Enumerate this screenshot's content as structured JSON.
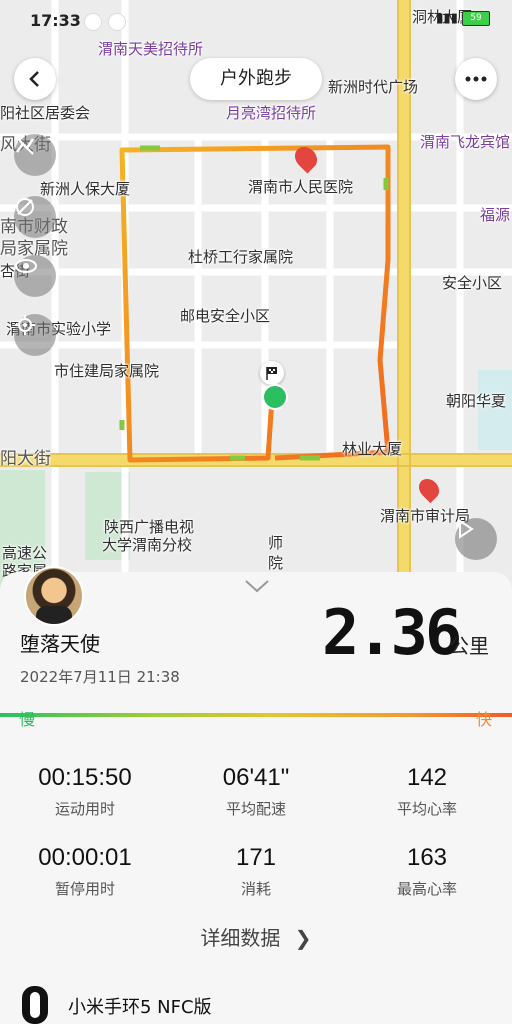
{
  "status_bar": {
    "time": "17:33",
    "battery": "59"
  },
  "header": {
    "back_icon": "back-arrow-icon",
    "title": "户外跑步",
    "more_icon": "more-dots-icon"
  },
  "map": {
    "labels": [
      {
        "text": "渭南天美招待所",
        "style": "purple"
      },
      {
        "text": "新洲时代广场",
        "style": "normal"
      },
      {
        "text": "月亮湾招待所",
        "style": "purple"
      },
      {
        "text": "阳社区居委会",
        "style": "normal"
      },
      {
        "text": "渭南飞龙宾馆",
        "style": "purple"
      },
      {
        "text": "风大街",
        "style": "big"
      },
      {
        "text": "渭南市人民医院",
        "style": "normal"
      },
      {
        "text": "新洲人保大厦",
        "style": "normal"
      },
      {
        "text": "福源",
        "style": "purple"
      },
      {
        "text": "南市财政",
        "style": "big"
      },
      {
        "text": "局家属院",
        "style": "big"
      },
      {
        "text": "杜桥工行家属院",
        "style": "normal"
      },
      {
        "text": "杏街",
        "style": "normal"
      },
      {
        "text": "安全小区",
        "style": "normal"
      },
      {
        "text": "邮电安全小区",
        "style": "normal"
      },
      {
        "text": "渭南市实验小学",
        "style": "normal"
      },
      {
        "text": "市住建局家属院",
        "style": "normal"
      },
      {
        "text": "朝阳华夏",
        "style": "normal"
      },
      {
        "text": "林业大厦",
        "style": "normal"
      },
      {
        "text": "阳大街",
        "style": "big"
      },
      {
        "text": "渭南市审计局",
        "style": "normal"
      },
      {
        "text": "陕西广播电视",
        "style": "normal"
      },
      {
        "text": "大学渭南分校",
        "style": "normal"
      },
      {
        "text": "师",
        "style": "normal"
      },
      {
        "text": "院",
        "style": "normal"
      },
      {
        "text": "高速公",
        "style": "normal"
      },
      {
        "text": "路家属",
        "style": "normal"
      },
      {
        "text": "洞林大厦",
        "style": "normal"
      }
    ],
    "tools": [
      "stats-off-icon",
      "route-hide-icon",
      "eye-icon",
      "locate-icon"
    ],
    "play_icon": "play-icon"
  },
  "summary": {
    "username": "堕落天使",
    "datetime": "2022年7月11日 21:38",
    "distance": "2.36",
    "distance_unit": "公里",
    "pace_slow": "慢",
    "pace_fast": "快"
  },
  "stats": [
    {
      "value": "00:15:50",
      "label": "运动用时"
    },
    {
      "value": "06'41\"",
      "label": "平均配速"
    },
    {
      "value": "142",
      "label": "平均心率"
    },
    {
      "value": "00:00:01",
      "label": "暂停用时"
    },
    {
      "value": "171",
      "label": "消耗"
    },
    {
      "value": "163",
      "label": "最高心率"
    }
  ],
  "detail_link": "详细数据",
  "device": "小米手环5 NFC版",
  "colors": {
    "route_start": "#f5a623",
    "route_end": "#f06b1e",
    "start_dot": "#2bbf61"
  }
}
